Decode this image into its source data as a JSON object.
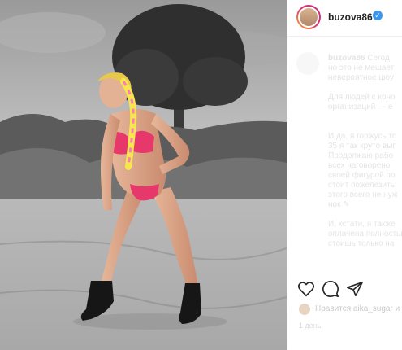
{
  "post": {
    "username": "buzova86",
    "verified_icon": "verified-badge-icon",
    "photo_alt": "photo"
  },
  "caption": {
    "username": "buzova86",
    "text": "Сегод\nно это не мешает\nневероятное шоу\n\nДля людей с коно\nорганизаций — е\n\n\nИ да, я горжусь то\n35 я так круто выг\nПродолжаю рабо\nвсех наговорено\nсвоей фигурой по\nстоит пожелезить\nэтого всего не нуж\nнок ✎\n\nИ, кстати, я также\nоплачена полностью\nстоишь только на"
  },
  "actions": {
    "like_icon": "heart-icon",
    "comment_icon": "comment-icon",
    "share_icon": "share-icon"
  },
  "likes": {
    "text": "Нравится aika_sugar и"
  },
  "date": {
    "text": "1 день"
  },
  "colors": {
    "verified": "#3897f0",
    "bikini": "#e7386b",
    "hair_highlight": "#f6e84c"
  }
}
